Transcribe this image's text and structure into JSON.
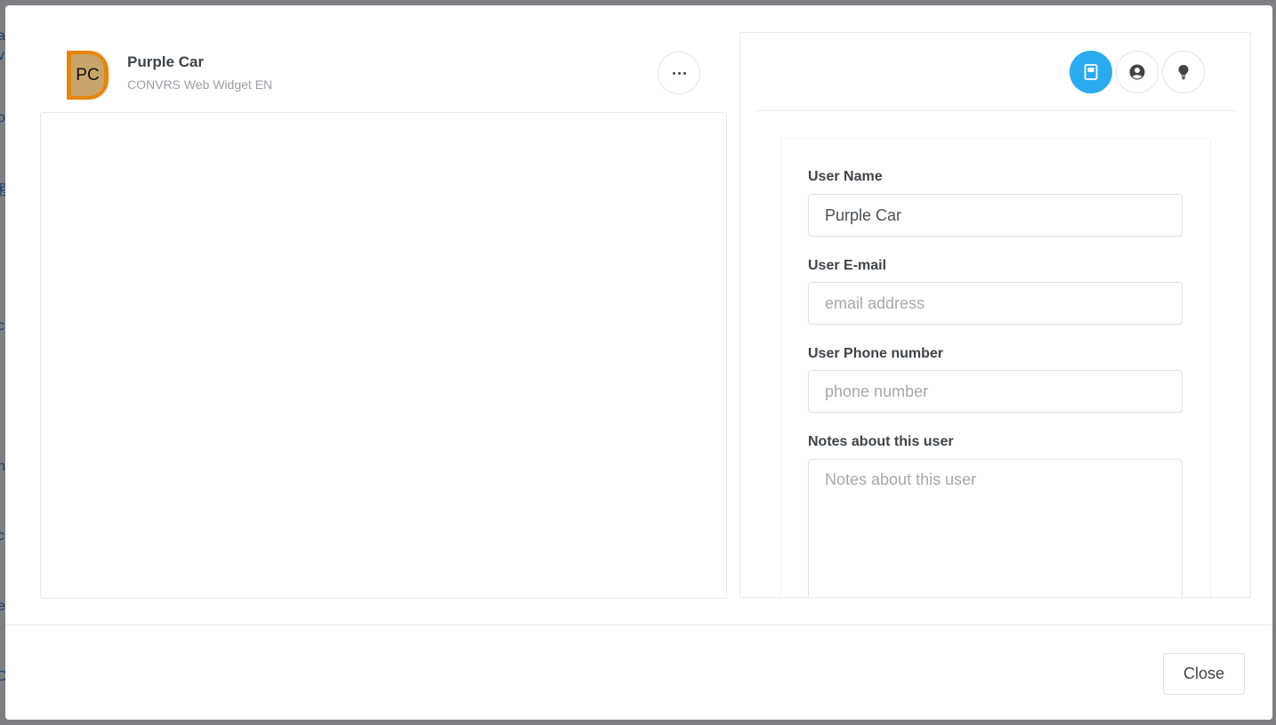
{
  "background": {
    "edge_chars": [
      "a",
      "vi",
      "o",
      "程",
      "c",
      "I",
      "n",
      "c",
      "e",
      "D"
    ]
  },
  "chat": {
    "avatar_initials": "PC",
    "contact_name": "Purple Car",
    "channel": "CONVRS Web Widget EN",
    "more_icon": "more-horizontal-icon"
  },
  "side_panel": {
    "tabs": [
      {
        "name": "notes",
        "icon": "notebook-icon",
        "active": true
      },
      {
        "name": "user",
        "icon": "user-circle-icon",
        "active": false
      },
      {
        "name": "tips",
        "icon": "lightbulb-icon",
        "active": false
      }
    ],
    "form": {
      "user_name_label": "User Name",
      "user_name_value": "Purple Car",
      "user_email_label": "User E-mail",
      "user_email_placeholder": "email address",
      "user_phone_label": "User Phone number",
      "user_phone_placeholder": "phone number",
      "notes_label": "Notes about this user",
      "notes_placeholder": "Notes about this user"
    }
  },
  "footer": {
    "close_label": "Close"
  },
  "colors": {
    "accent": "#2aabf1",
    "avatar_border": "#e8850d",
    "avatar_fill": "#c9a46a"
  }
}
